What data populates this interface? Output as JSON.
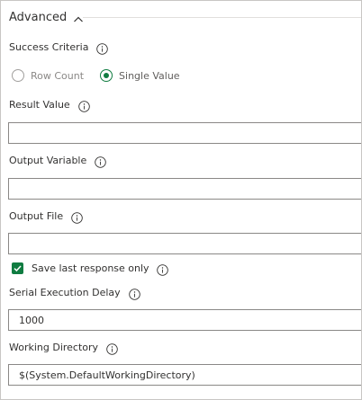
{
  "section": {
    "title": "Advanced",
    "chevron_icon": "chevron-up-icon"
  },
  "colors": {
    "accent": "#107c41",
    "border": "#8a8886",
    "text": "#323130",
    "disabled_text": "#8a8886",
    "rule": "#e1dfdd"
  },
  "success_criteria": {
    "label": "Success Criteria",
    "info_icon": "info-icon",
    "options": [
      {
        "label": "Row Count",
        "selected": false
      },
      {
        "label": "Single Value",
        "selected": true
      }
    ]
  },
  "result_value": {
    "label": "Result Value",
    "info_icon": "info-icon",
    "value": ""
  },
  "output_variable": {
    "label": "Output Variable",
    "info_icon": "info-icon",
    "value": ""
  },
  "output_file": {
    "label": "Output File",
    "info_icon": "info-icon",
    "value": ""
  },
  "save_last_response": {
    "label": "Save last response only",
    "checked": true,
    "info_icon": "info-icon"
  },
  "serial_execution_delay": {
    "label": "Serial Execution Delay",
    "info_icon": "info-icon",
    "value": "1000"
  },
  "working_directory": {
    "label": "Working Directory",
    "info_icon": "info-icon",
    "value": "$(System.DefaultWorkingDirectory)"
  }
}
